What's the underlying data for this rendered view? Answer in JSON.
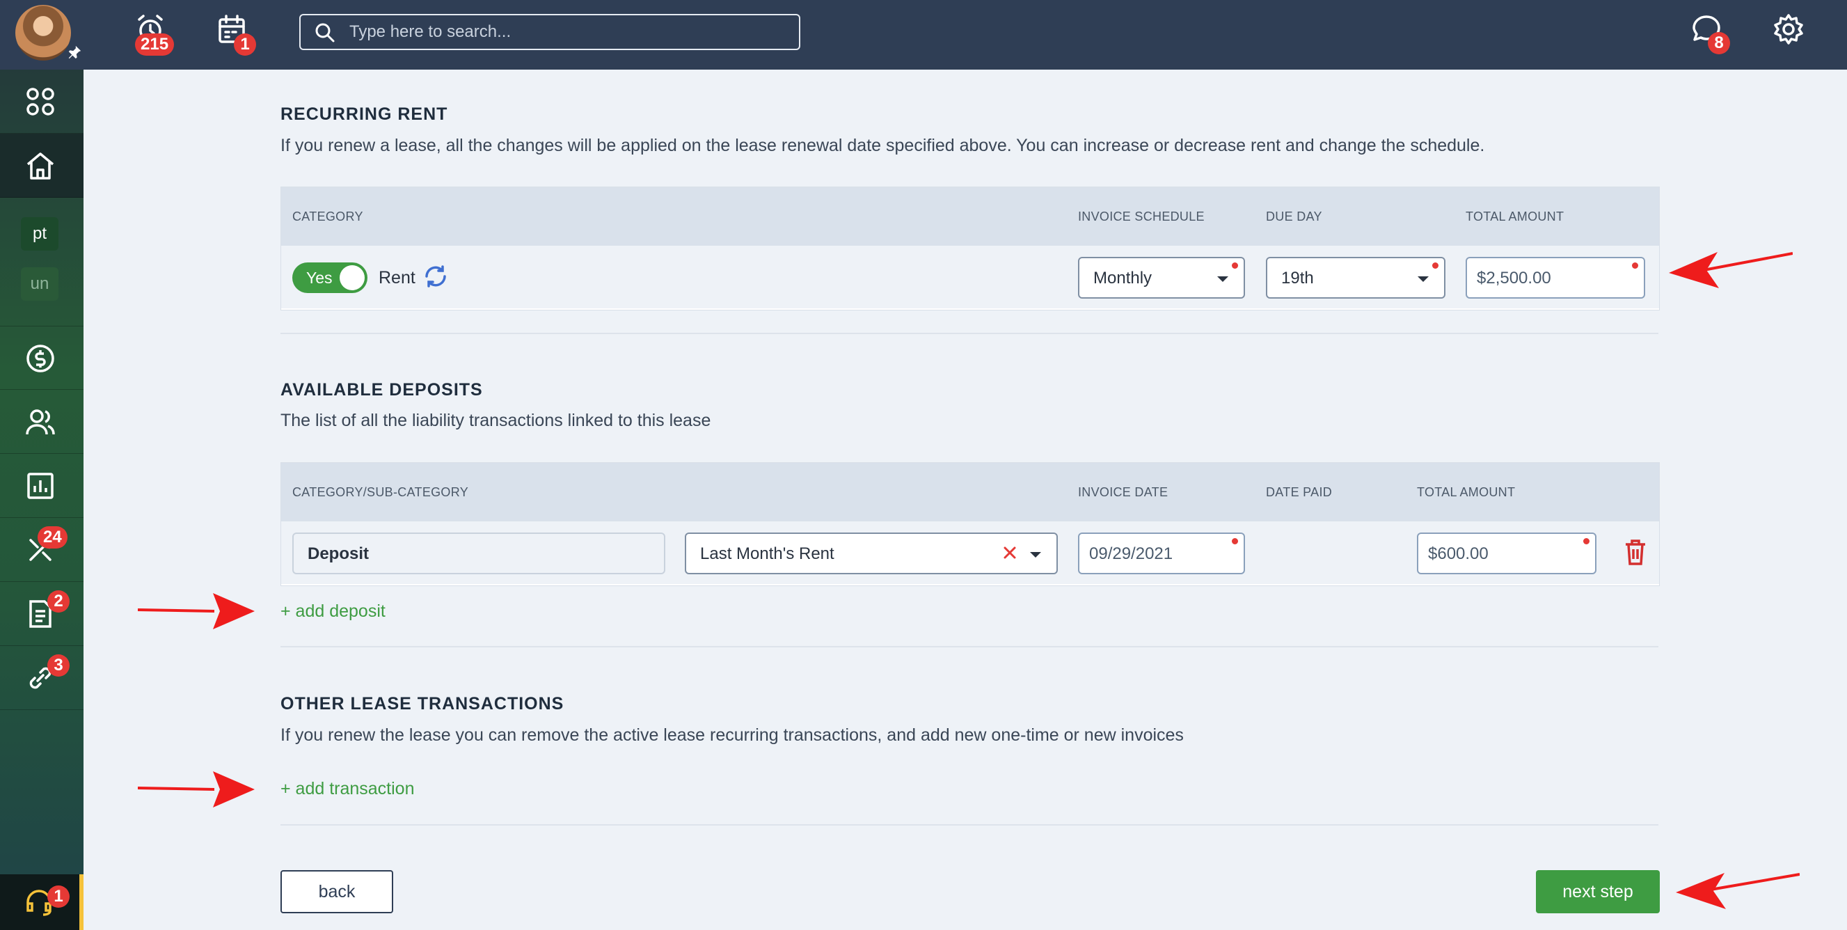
{
  "topbar": {
    "alarm_badge": "215",
    "calendar_badge": "1",
    "search_placeholder": "Type here to search...",
    "chat_badge": "8"
  },
  "sidebar": {
    "chips": [
      "pt",
      "un"
    ],
    "tools_badge": "24",
    "docs_badge": "2",
    "links_badge": "3",
    "support_badge": "1"
  },
  "recurring": {
    "title": "RECURRING RENT",
    "description": "If you renew a lease, all the changes will be applied on the lease renewal date specified above. You can increase or decrease rent and change the schedule.",
    "headers": {
      "category": "CATEGORY",
      "invoice_schedule": "INVOICE SCHEDULE",
      "due_day": "DUE DAY",
      "total_amount": "TOTAL AMOUNT"
    },
    "row": {
      "toggle_label": "Yes",
      "category": "Rent",
      "invoice_schedule": "Monthly",
      "due_day": "19th",
      "total_amount": "$2,500.00"
    }
  },
  "deposits": {
    "title": "AVAILABLE DEPOSITS",
    "description": "The list of all the liability transactions linked to this lease",
    "headers": {
      "category": "CATEGORY/SUB-CATEGORY",
      "invoice_date": "INVOICE DATE",
      "date_paid": "DATE PAID",
      "total_amount": "TOTAL AMOUNT"
    },
    "row": {
      "category": "Deposit",
      "sub_category": "Last Month's Rent",
      "invoice_date": "09/29/2021",
      "total_amount": "$600.00"
    },
    "add_link": "+ add deposit"
  },
  "other": {
    "title": "OTHER LEASE TRANSACTIONS",
    "description": "If you renew the lease you can remove the active lease recurring transactions, and add new one-time or new invoices",
    "add_link": "+ add transaction"
  },
  "footer": {
    "back_label": "back",
    "next_label": "next step"
  },
  "colors": {
    "topbar": "#2f3e55",
    "accent_green": "#3e9c42",
    "badge_red": "#e53935",
    "annotation_arrow": "#ee1c1c"
  }
}
